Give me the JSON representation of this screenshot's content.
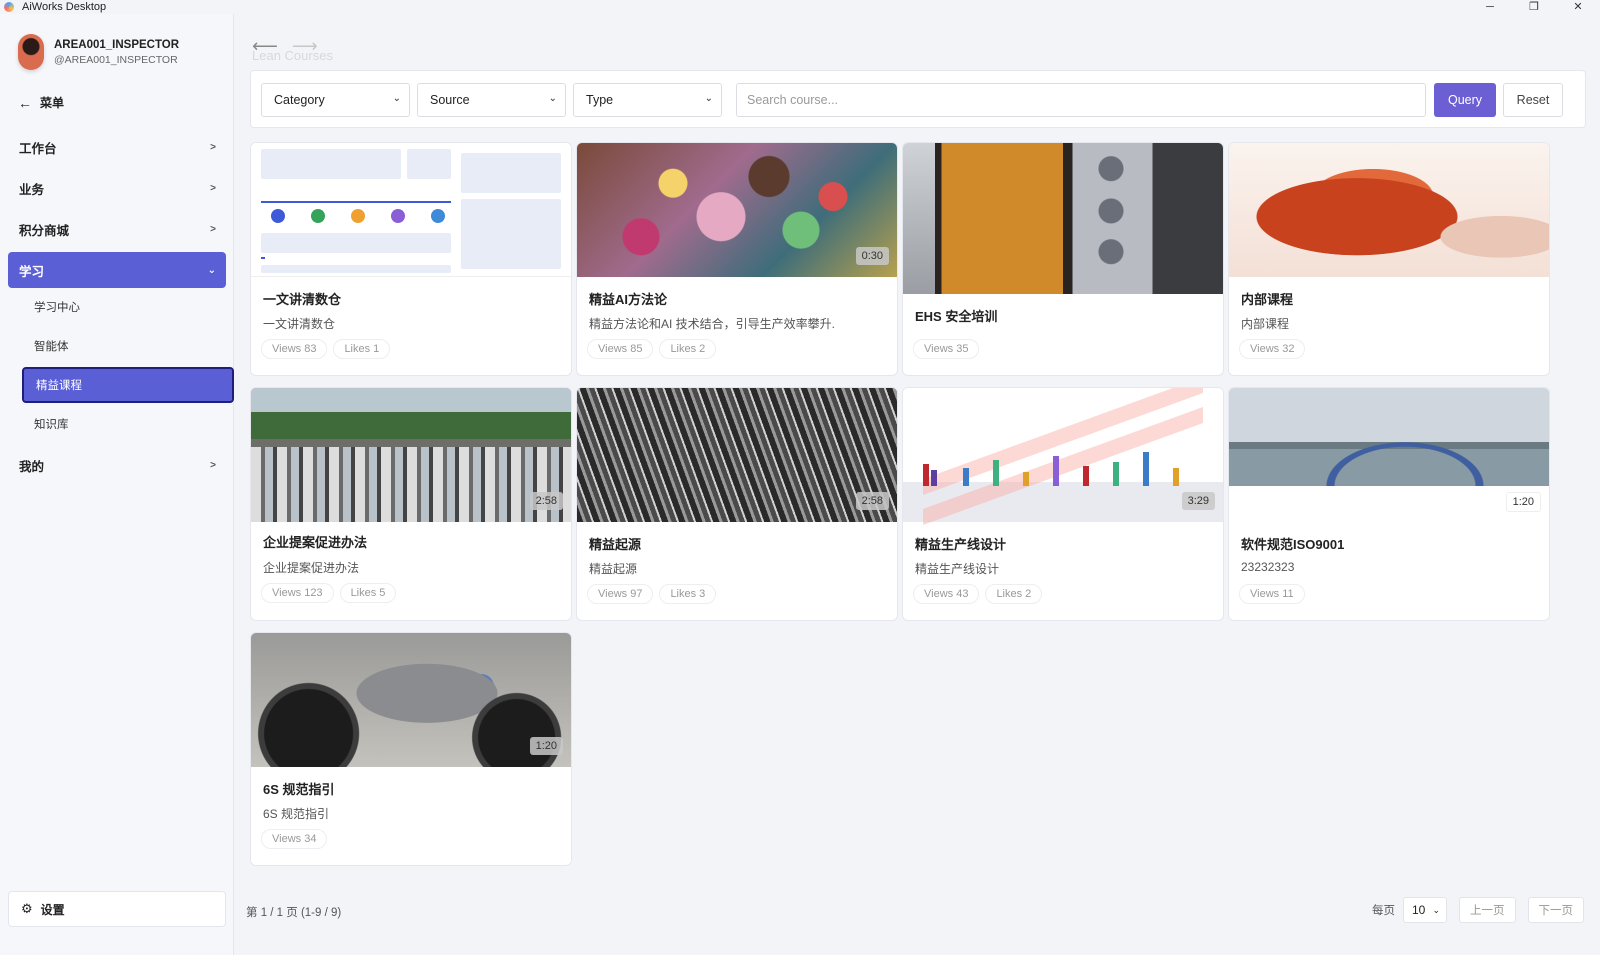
{
  "window": {
    "title": "AiWorks Desktop",
    "controls": {
      "minimize": "─",
      "restore": "❐",
      "close": "✕"
    }
  },
  "user": {
    "name": "AREA001_INSPECTOR",
    "handle": "@AREA001_INSPECTOR"
  },
  "sidebar": {
    "back_label": "菜单",
    "items": [
      {
        "label": "工作台",
        "expanded": false
      },
      {
        "label": "业务",
        "expanded": false
      },
      {
        "label": "积分商城",
        "expanded": false
      },
      {
        "label": "学习",
        "expanded": true
      },
      {
        "label": "我的",
        "expanded": false
      }
    ],
    "sub_items": [
      {
        "label": "学习中心",
        "active": false
      },
      {
        "label": "智能体",
        "active": false
      },
      {
        "label": "精益课程",
        "active": true
      },
      {
        "label": "知识库",
        "active": false
      }
    ],
    "settings_label": "设置",
    "active_color": "#5b5fd6"
  },
  "header": {
    "faded_title": "Lean Courses"
  },
  "filters": {
    "category": "Category",
    "source": "Source",
    "type": "Type",
    "search_placeholder": "Search course...",
    "query_label": "Query",
    "reset_label": "Reset",
    "accent_color": "#6c5fd3"
  },
  "courses": [
    {
      "title": "一文讲清数仓",
      "desc": "一文讲清数仓",
      "duration": "",
      "views": "Views 83",
      "likes": "Likes 1",
      "thumb": "crm-diagram"
    },
    {
      "title": "精益AI方法论",
      "desc": "精益方法论和AI 技术结合，引导生产效率攀升.",
      "duration": "0:30",
      "views": "Views 85",
      "likes": "Likes 2",
      "thumb": "candy-market"
    },
    {
      "title": "EHS 安全培训",
      "desc": "",
      "duration": "",
      "views": "Views 35",
      "likes": "",
      "thumb": "oven"
    },
    {
      "title": "内部课程",
      "desc": "内部课程",
      "duration": "",
      "views": "Views 32",
      "likes": "",
      "thumb": "crab"
    },
    {
      "title": "企业提案促进办法",
      "desc": "企业提案促进办法",
      "duration": "2:58",
      "views": "Views 123",
      "likes": "Likes 5",
      "thumb": "traffic"
    },
    {
      "title": "精益起源",
      "desc": "精益起源",
      "duration": "2:58",
      "views": "Views 97",
      "likes": "Likes 3",
      "thumb": "factory"
    },
    {
      "title": "精益生产线设计",
      "desc": "精益生产线设计",
      "duration": "3:29",
      "views": "Views 43",
      "likes": "Likes 2",
      "thumb": "production-line"
    },
    {
      "title": "软件规范ISO9001",
      "desc": "23232323",
      "duration": "1:20",
      "views": "Views 11",
      "likes": "",
      "thumb": "bridge"
    },
    {
      "title": "6S 规范指引",
      "desc": "6S 规范指引",
      "duration": "1:20",
      "views": "Views 34",
      "likes": "",
      "thumb": "motorcycle"
    }
  ],
  "pagination": {
    "info": "第 1 / 1 页  (1-9 / 9)",
    "per_page_label": "每页",
    "per_page_value": "10",
    "prev_label": "上一页",
    "next_label": "下一页"
  }
}
